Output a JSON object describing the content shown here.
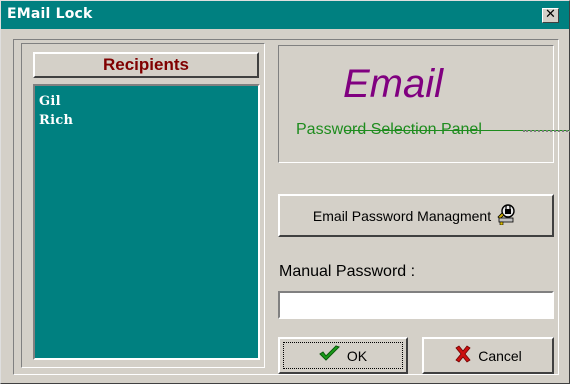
{
  "window": {
    "title": "EMail Lock",
    "close_glyph": "✕"
  },
  "recipients": {
    "header": "Recipients",
    "items": [
      "Gil",
      "Rich"
    ]
  },
  "email_panel": {
    "title": "Email",
    "subtitle": "Password Selection Panel"
  },
  "buttons": {
    "management_label": "Email Password Managment",
    "management_icon": "key-lock-icon",
    "ok_label": "OK",
    "ok_icon": "checkmark-icon",
    "cancel_label": "Cancel",
    "cancel_icon": "x-cross-icon"
  },
  "manual_password": {
    "label": "Manual Password :",
    "value": ""
  },
  "colors": {
    "titlebar": "#008080",
    "list_background": "#008080",
    "header_text": "#800000",
    "email_title": "#800080",
    "email_subtitle": "#1e8c1e"
  }
}
